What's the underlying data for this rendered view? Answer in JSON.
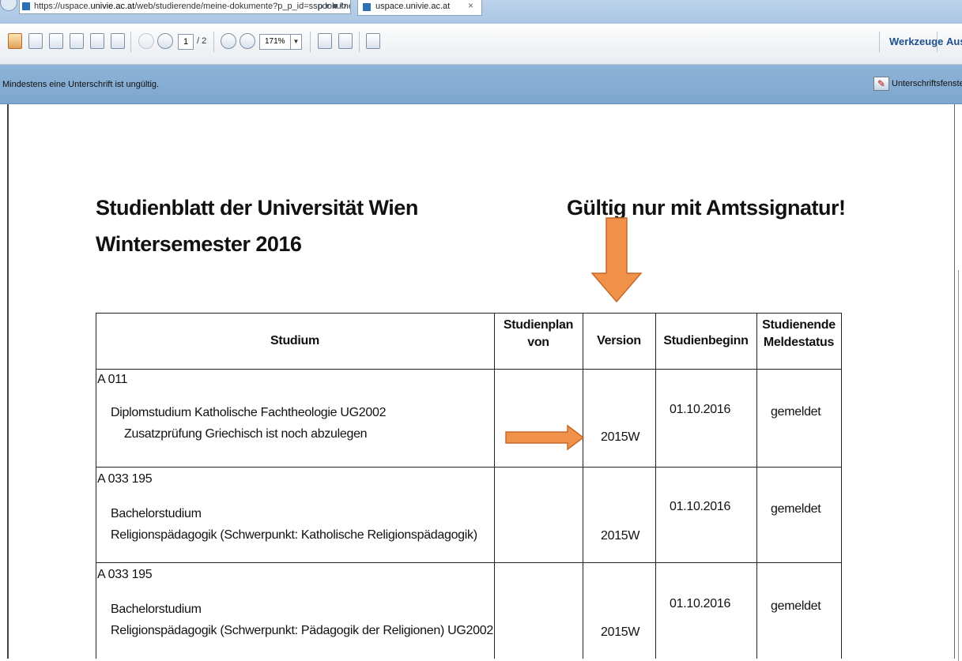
{
  "browser": {
    "url_prefix": "https://uspace.",
    "url_host": "univie.ac.at",
    "url_path": "/web/studierende/meine-dokumente?p_p_id=sspdokumei",
    "url_controls": "ρ ▾ ■ ↻",
    "tab_title": "uspace.univie.ac.at",
    "tab_close": "×"
  },
  "toolbar": {
    "page_current": "1",
    "page_total": "/ 2",
    "zoom": "171%",
    "tools_label": "Werkzeuge",
    "more_label": "Aus"
  },
  "signature_bar": {
    "message": "Mindestens eine Unterschrift ist ungültig.",
    "button_label": "Unterschriftsfenster"
  },
  "document": {
    "title_line1": "Studienblatt der Universität Wien",
    "title_line2": "Wintersemester 2016",
    "validity_note": "Gültig nur mit Amtssignatur!",
    "table": {
      "headers": {
        "studium": "Studium",
        "studienplan_1": "Studienplan",
        "studienplan_2": "von",
        "version": "Version",
        "studienbeginn": "Studienbeginn",
        "status_1": "Studienende",
        "status_2": "Meldestatus"
      },
      "rows": [
        {
          "code": "A 011",
          "line1": "Diplomstudium Katholische Fachtheologie UG2002",
          "line2": "Zusatzprüfung Griechisch ist noch abzulegen",
          "version": "2015W",
          "begin": "01.10.2016",
          "status": "gemeldet"
        },
        {
          "code": "A 033 195",
          "line1": "Bachelorstudium",
          "line2": "Religionspädagogik (Schwerpunkt: Katholische Religionspädagogik)",
          "version": "2015W",
          "begin": "01.10.2016",
          "status": "gemeldet"
        },
        {
          "code": "A 033 195",
          "line1": "Bachelorstudium",
          "line2": "Religionspädagogik (Schwerpunkt: Pädagogik der Religionen) UG2002",
          "version": "2015W",
          "begin": "01.10.2016",
          "status": "gemeldet"
        }
      ]
    }
  },
  "colors": {
    "annotation_arrow": "#f0924a",
    "signature_bar": "#8eb3d6",
    "link": "#1d4f91"
  }
}
